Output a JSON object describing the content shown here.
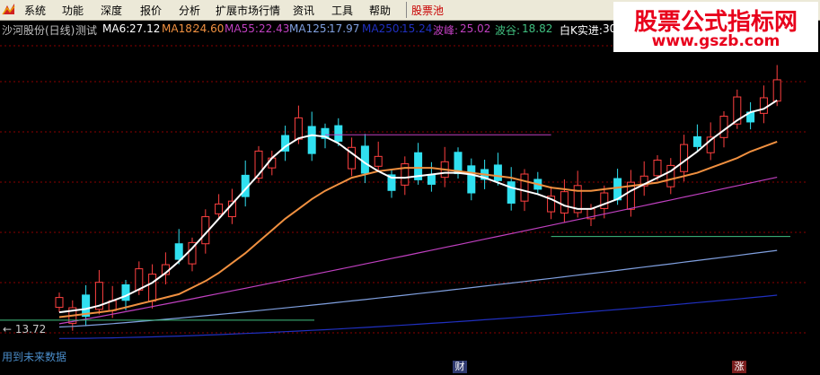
{
  "menu": {
    "items": [
      "系统",
      "功能",
      "深度",
      "报价",
      "分析",
      "扩展市场行情",
      "资讯",
      "工具",
      "帮助"
    ],
    "highlight_item": "股票池"
  },
  "watermark": {
    "title": "股票公式指标网",
    "url": "www.gszb.com"
  },
  "info": {
    "stock": "沙河股份(日线)",
    "formula": "测试",
    "ma6_label": "MA6:",
    "ma6_value": "27.12",
    "ma18_label": "MA18:",
    "ma18_value": "24.60",
    "ma55_label": "MA55:",
    "ma55_value": "22.43",
    "ma125_label": "MA125:",
    "ma125_value": "17.97",
    "ma250_label": "MA250:",
    "ma250_value": "15.24",
    "peak_label": "波峰:",
    "peak_value": "25.02",
    "trough_label": "波谷:",
    "trough_value": "18.82",
    "whitek_label": "白K实进:",
    "whitek_value": "30"
  },
  "labels": {
    "low_marker": "← 13.72",
    "future_data": "用到未来数据",
    "cai": "财",
    "zhang": "涨"
  },
  "colors": {
    "ma6": "#ffffff",
    "ma18": "#f09040",
    "ma55": "#c040c0",
    "ma125": "#80a0e0",
    "ma250": "#2030c0",
    "up": "#ff4040",
    "down": "#30e0f0",
    "peak": "#c040c0",
    "trough": "#40c080",
    "grid": "#8b0000"
  },
  "chart_data": {
    "type": "candlestick",
    "series": [
      {
        "name": "MA6",
        "values": [
          14.2,
          14.3,
          14.4,
          14.6,
          14.9,
          15.2,
          15.6,
          16.0,
          16.6,
          17.3,
          18.1,
          19.0,
          19.9,
          20.8,
          21.7,
          22.6,
          23.6,
          24.3,
          24.8,
          25.0,
          24.9,
          24.5,
          23.9,
          23.3,
          22.8,
          22.4,
          22.4,
          22.5,
          22.6,
          22.7,
          22.7,
          22.6,
          22.4,
          22.1,
          21.8,
          21.6,
          21.4,
          21.1,
          20.7,
          20.5,
          20.5,
          20.8,
          21.1,
          21.6,
          22.0,
          22.4,
          22.8,
          23.4,
          24.0,
          24.7,
          25.3,
          25.9,
          26.4,
          26.6,
          27.12
        ]
      },
      {
        "name": "MA18",
        "values": [
          13.9,
          14.0,
          14.1,
          14.2,
          14.3,
          14.5,
          14.7,
          14.9,
          15.1,
          15.3,
          15.7,
          16.1,
          16.6,
          17.2,
          17.8,
          18.5,
          19.2,
          19.9,
          20.5,
          21.1,
          21.6,
          22.0,
          22.4,
          22.6,
          22.8,
          22.9,
          23.0,
          23.0,
          23.0,
          22.9,
          22.8,
          22.7,
          22.6,
          22.5,
          22.4,
          22.2,
          22.0,
          21.8,
          21.7,
          21.6,
          21.6,
          21.7,
          21.8,
          21.9,
          22.0,
          22.1,
          22.3,
          22.5,
          22.7,
          23.0,
          23.3,
          23.6,
          24.0,
          24.3,
          24.6
        ]
      }
    ],
    "ylim": [
      13.0,
      30.5
    ]
  }
}
